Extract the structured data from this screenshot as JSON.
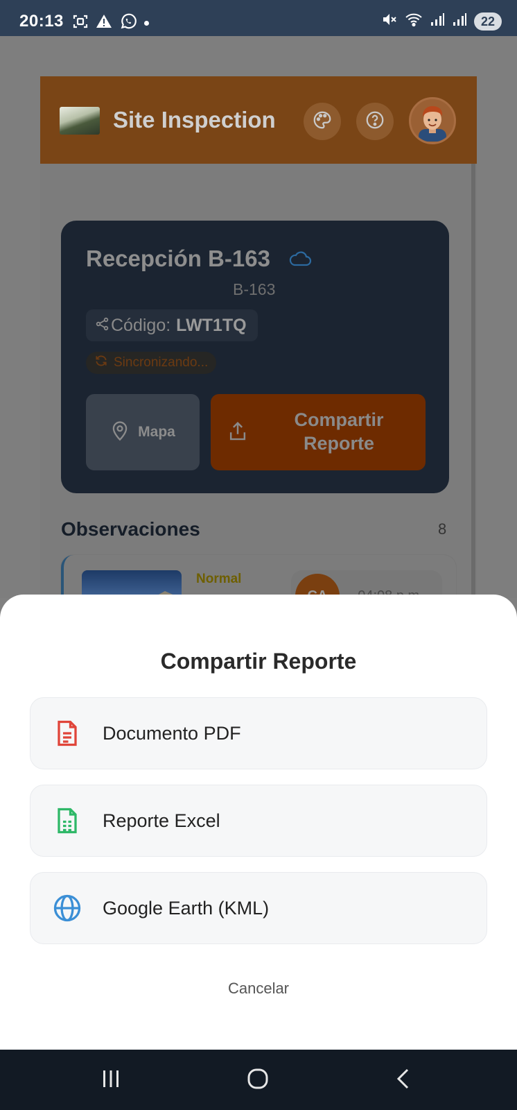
{
  "status_bar": {
    "time": "20:13",
    "battery": "22",
    "left_icons": [
      "screenshot-icon",
      "warning-icon",
      "whatsapp-icon",
      "notification-dot"
    ],
    "right_icons": [
      "mute-icon",
      "wifi-icon",
      "signal-icon",
      "signal-icon"
    ]
  },
  "app": {
    "title": "Site Inspection",
    "header_color": "#ea7a1f",
    "header_buttons": [
      "palette-icon",
      "help-icon"
    ],
    "avatar": "user-avatar"
  },
  "project": {
    "name": "Recepción B-163",
    "subtitle": "B-163",
    "code_label": "Código:",
    "code_value": "LWT1TQ",
    "sync_status": "Sincronizando...",
    "map_button": "Mapa",
    "share_button": "Compartir Reporte"
  },
  "observations": {
    "title": "Observaciones",
    "count": "8",
    "items": [
      {
        "level": "Normal",
        "initials": "CA",
        "time": "04:08 p.m."
      }
    ]
  },
  "sheet": {
    "title": "Compartir Reporte",
    "options": [
      {
        "label": "Documento PDF",
        "icon": "pdf-file-icon",
        "color": "#e0453a"
      },
      {
        "label": "Reporte Excel",
        "icon": "excel-file-icon",
        "color": "#2fb868"
      },
      {
        "label": "Google Earth (KML)",
        "icon": "globe-icon",
        "color": "#3b8fd6"
      }
    ],
    "cancel": "Cancelar"
  },
  "nav_bar": {
    "buttons": [
      "recent-apps-icon",
      "home-icon",
      "back-icon"
    ]
  }
}
